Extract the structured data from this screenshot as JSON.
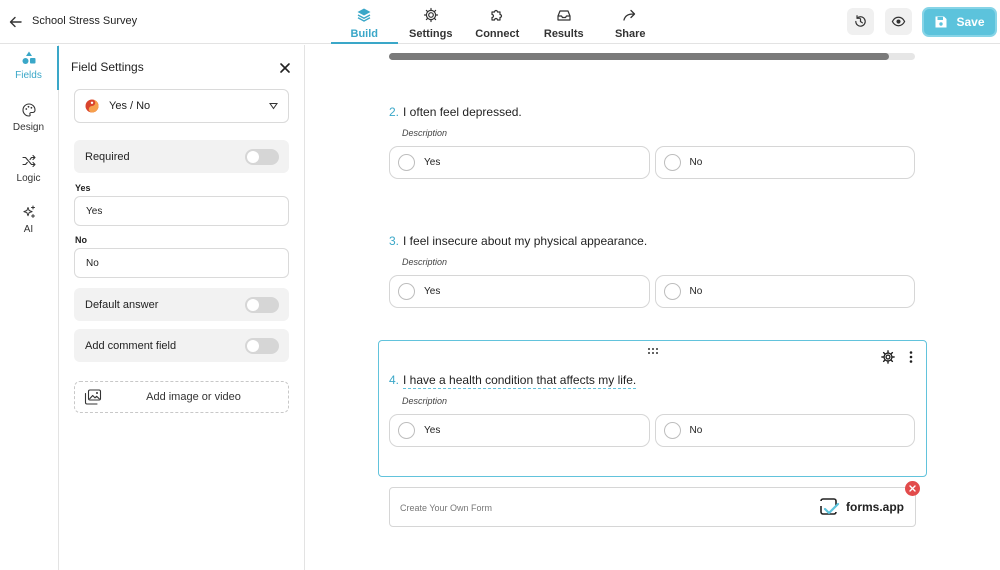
{
  "header": {
    "form_title": "School Stress Survey",
    "tabs": [
      {
        "label": "Build",
        "icon": "layers-icon",
        "active": true
      },
      {
        "label": "Settings",
        "icon": "gear-icon",
        "active": false
      },
      {
        "label": "Connect",
        "icon": "puzzle-icon",
        "active": false
      },
      {
        "label": "Results",
        "icon": "inbox-icon",
        "active": false
      },
      {
        "label": "Share",
        "icon": "share-arrow-icon",
        "active": false
      }
    ],
    "save_label": "Save"
  },
  "rail": {
    "items": [
      {
        "label": "Fields",
        "icon": "shapes-icon",
        "active": true
      },
      {
        "label": "Design",
        "icon": "palette-icon",
        "active": false
      },
      {
        "label": "Logic",
        "icon": "shuffle-icon",
        "active": false
      },
      {
        "label": "AI",
        "icon": "sparkles-icon",
        "active": false
      }
    ]
  },
  "field_settings": {
    "title": "Field Settings",
    "field_type": "Yes / No",
    "required_label": "Required",
    "required_on": false,
    "yes_label": "Yes",
    "yes_value": "Yes",
    "no_label": "No",
    "no_value": "No",
    "default_answer_label": "Default answer",
    "default_answer_on": false,
    "comment_field_label": "Add comment field",
    "comment_field_on": false,
    "add_media_label": "Add image or video"
  },
  "progress": {
    "value": 0.95
  },
  "questions": [
    {
      "number": "2.",
      "text": "I often feel depressed.",
      "description": "Description",
      "options": [
        "Yes",
        "No"
      ],
      "selected": false
    },
    {
      "number": "3.",
      "text": "I feel insecure about my physical appearance.",
      "description": "Description",
      "options": [
        "Yes",
        "No"
      ],
      "selected": false
    },
    {
      "number": "4.",
      "text": "I have a health condition that affects my life.",
      "description": "Description",
      "options": [
        "Yes",
        "No"
      ],
      "selected": true
    }
  ],
  "branding": {
    "text": "Create Your Own Form",
    "logo_name": "forms.app"
  },
  "colors": {
    "accent": "#3aa7c8",
    "save_button": "#5cc3dc",
    "close_badge": "#e24b4b"
  }
}
